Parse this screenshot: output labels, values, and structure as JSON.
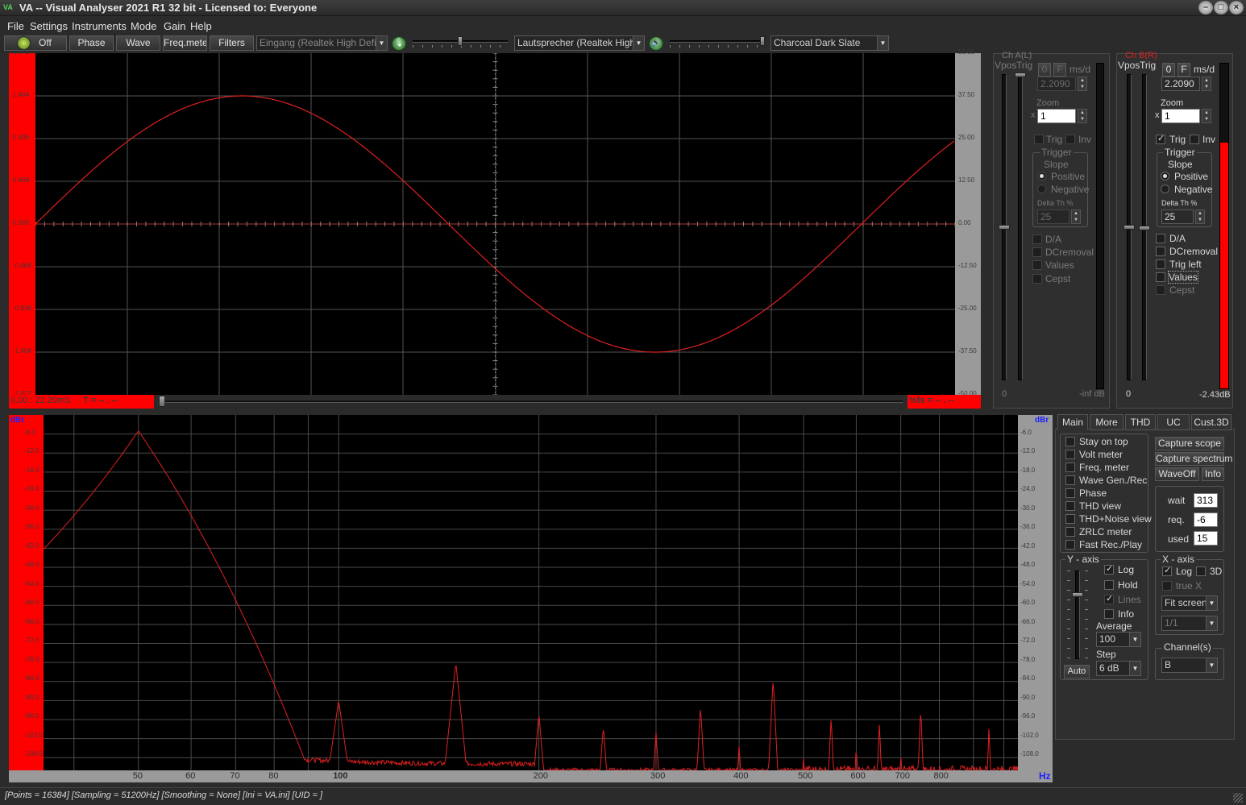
{
  "window": {
    "icon": "VA",
    "title": "VA -- Visual Analyser 2021 R1 32 bit - Licensed to: Everyone",
    "min_glyph": "–",
    "max_glyph": "□",
    "close_glyph": "×"
  },
  "menu": [
    "File",
    "Settings",
    "Instruments",
    "Mode",
    "Gain",
    "Help"
  ],
  "toolbar": {
    "power_label": "Off",
    "phase": "Phase",
    "wave": "Wave",
    "freqmeter": "Freq.meter",
    "filters": "Filters",
    "input_device": "Eingang (Realtek High Definiti",
    "output_device": "Lautsprecher (Realtek High D",
    "theme": "Charcoal Dark Slate",
    "dropdown_glyph": "▼"
  },
  "scope": {
    "y_left_labels": [
      "1.872",
      "1.404",
      "0.936",
      "0.468",
      "0.000",
      "-0.468",
      "-0.936",
      "-1.404",
      "-1.872"
    ],
    "y_right_labels": [
      "50.00",
      "37.50",
      "25.00",
      "12.50",
      "0.00",
      "-12.50",
      "-25.00",
      "-37.50",
      "-50.00"
    ],
    "time_readout": "0.00 : 22.29mS",
    "t_readout": "T = -- . --",
    "fs_readout": "%fs = -- . --",
    "trace_color": "#e02020"
  },
  "spectrum": {
    "y_unit": "dBr",
    "x_unit": "Hz",
    "y_labels": [
      "-6.0",
      "-12.0",
      "-18.0",
      "-24.0",
      "-30.0",
      "-36.0",
      "-42.0",
      "-48.0",
      "-54.0",
      "-60.0",
      "-66.0",
      "-72.0",
      "-78.0",
      "-84.0",
      "-90.0",
      "-96.0",
      "-102.0",
      "-108.0"
    ],
    "x_labels": [
      "50",
      "60",
      "70",
      "80",
      "100",
      "200",
      "300",
      "400",
      "500",
      "600",
      "700",
      "800"
    ]
  },
  "chA": {
    "title": "Ch A(L)",
    "vpos": "Vpos",
    "trig": "Trig",
    "zero": "0",
    "f": "F",
    "msd": "ms/d",
    "msd_value": "2.2090",
    "zoom_label": "Zoom",
    "zoom_x": "x",
    "zoom_value": "1",
    "trig_chk": "Trig",
    "inv_chk": "Inv",
    "trigger_group": "Trigger",
    "slope": "Slope",
    "positive": "Positive",
    "negative": "Negative",
    "delta": "Delta Th %",
    "delta_value": "25",
    "da": "D/A",
    "dcremoval": "DCremoval",
    "values": "Values",
    "cepst": "Cepst",
    "bottom_zero": "0",
    "level": "-inf dB"
  },
  "chB": {
    "title": "Ch B(R)",
    "vpos": "Vpos",
    "trig": "Trig",
    "zero": "0",
    "f": "F",
    "msd": "ms/d",
    "msd_value": "2.2090",
    "zoom_label": "Zoom",
    "zoom_x": "x",
    "zoom_value": "1",
    "trig_chk": "Trig",
    "inv_chk": "Inv",
    "trigger_group": "Trigger",
    "slope": "Slope",
    "positive": "Positive",
    "negative": "Negative",
    "delta": "Delta Th %",
    "delta_value": "25",
    "da": "D/A",
    "dcremoval": "DCremoval",
    "trigleft": "Trig left",
    "values": "Values",
    "cepst": "Cepst",
    "bottom_zero": "0",
    "level": "-2.43dB"
  },
  "tabs": [
    "Main",
    "More",
    "THD",
    "UC",
    "Cust.3D"
  ],
  "main_tab": {
    "checks": [
      "Stay on top",
      "Volt meter",
      "Freq. meter",
      "Wave Gen./Rec",
      "Phase",
      "THD view",
      "THD+Noise view",
      "ZRLC meter",
      "Fast Rec./Play"
    ],
    "capture_scope": "Capture scope",
    "capture_spectrum": "Capture spectrum",
    "waveoff": "WaveOff",
    "info": "Info",
    "wait_label": "wait",
    "wait_value": "313",
    "req_label": "req.",
    "req_value": "-6",
    "used_label": "used",
    "used_value": "15",
    "yaxis": "Y - axis",
    "y_log": "Log",
    "y_hold": "Hold",
    "y_lines": "Lines",
    "y_info": "Info",
    "average_label": "Average",
    "average_value": "100",
    "step_label": "Step",
    "step_value": "6 dB",
    "auto": "Auto",
    "xaxis": "X - axis",
    "x_log": "Log",
    "x_3d": "3D",
    "x_truex": "true X",
    "fit": "Fit screen",
    "ratio": "1/1",
    "channels_label": "Channel(s)",
    "channels_value": "B"
  },
  "status": "[Points = 16384]  [Sampling = 51200Hz]  [Smoothing = None]  [Ini = VA.ini]  [UID = ]"
}
